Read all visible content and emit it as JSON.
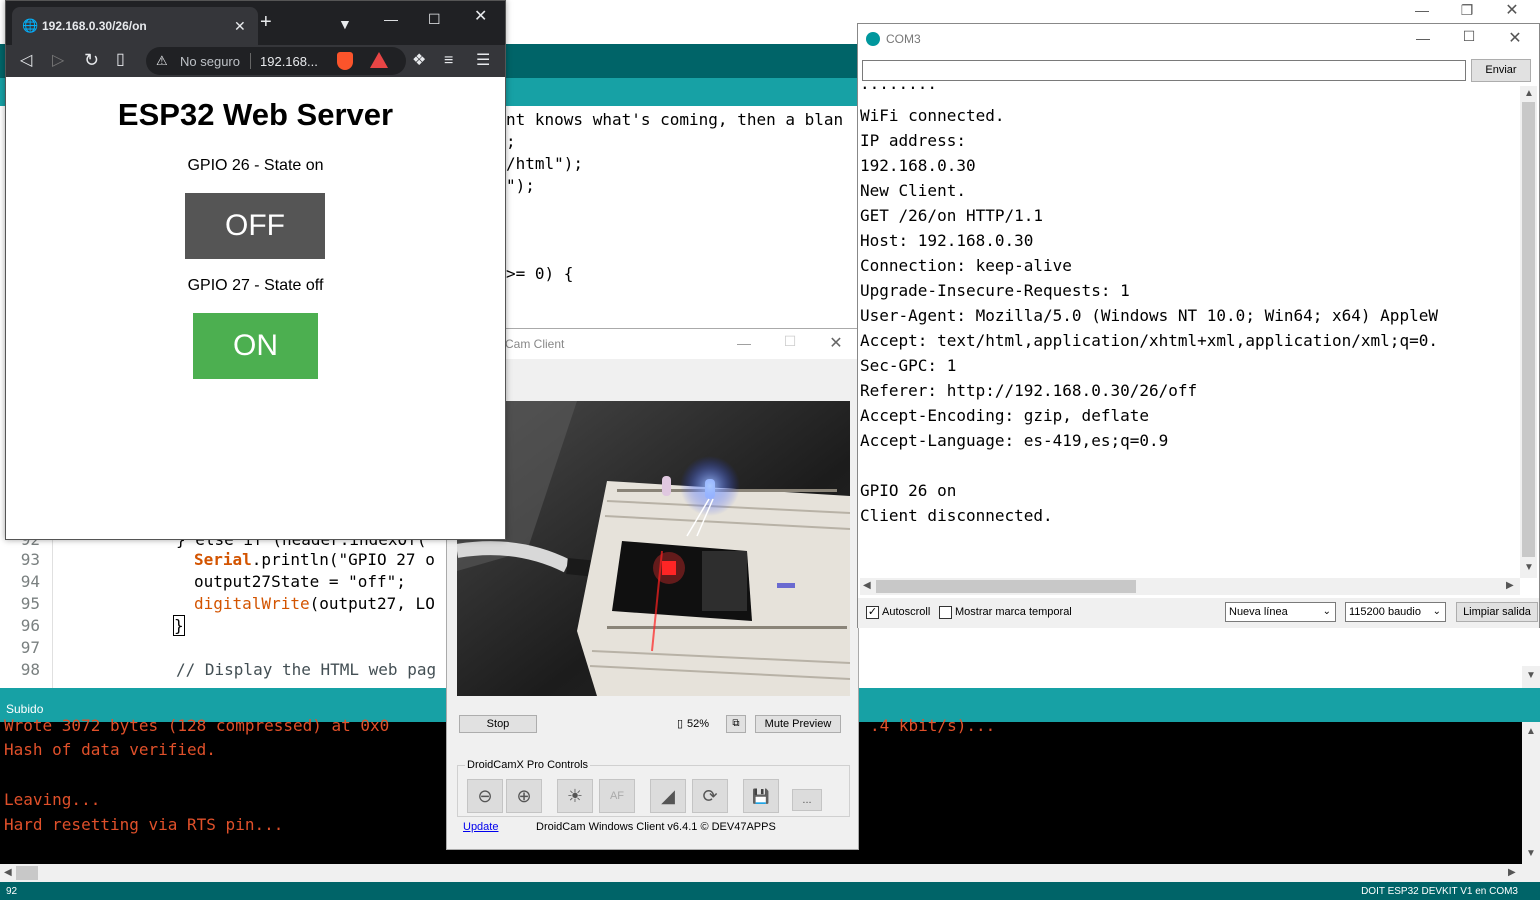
{
  "ide": {
    "code_fragments": [
      "nt knows what's coming, then a blan",
      ";",
      "/html\");",
      "\");",
      ">= 0) {"
    ],
    "lines": [
      {
        "num": "92",
        "text": "} else if (header.indexOf("
      },
      {
        "num": "93",
        "keyword": "Serial",
        "text": ".println(\"GPIO 27 o"
      },
      {
        "num": "94",
        "text": "output27State = \"off\";"
      },
      {
        "num": "95",
        "keyword": "digitalWrite",
        "text": "(output27, LO"
      },
      {
        "num": "96",
        "text": "}"
      },
      {
        "num": "97",
        "text": ""
      },
      {
        "num": "98",
        "text": "// Display the HTML web pag"
      }
    ],
    "status_label": "Subido",
    "console": [
      "Wrote 3072 bytes (128 compressed) at 0x0",
      "Hash of data verified.",
      "",
      "Leaving...",
      "Hard resetting via RTS pin..."
    ],
    "console_right_fragment": ".4 kbit/s)...",
    "bottom_line": "92",
    "bottom_board": "DOIT ESP32 DEVKIT V1 en COM3"
  },
  "browser": {
    "tab_title": "192.168.0.30/26/on",
    "security_label": "No seguro",
    "url": "192.168...",
    "page": {
      "heading": "ESP32 Web Server",
      "gpio26_label": "GPIO 26 - State on",
      "gpio26_button": "OFF",
      "gpio27_label": "GPIO 27 - State off",
      "gpio27_button": "ON"
    },
    "colors": {
      "off_button": "#555555",
      "on_button": "#4caf50"
    }
  },
  "droidcam": {
    "title": "Cam Client",
    "stop_button": "Stop",
    "battery": "52%",
    "mute_button": "Mute Preview",
    "pro_controls_label": "DroidCamX Pro Controls",
    "af_label": "AF",
    "more_label": "...",
    "update_link": "Update",
    "version": "DroidCam Windows Client v6.4.1 © DEV47APPS"
  },
  "serial": {
    "title": "COM3",
    "send_button": "Enviar",
    "output": [
      "........",
      "WiFi connected.",
      "IP address:",
      "192.168.0.30",
      "New Client.",
      "GET /26/on HTTP/1.1",
      "Host: 192.168.0.30",
      "Connection: keep-alive",
      "Upgrade-Insecure-Requests: 1",
      "User-Agent: Mozilla/5.0 (Windows NT 10.0; Win64; x64) AppleW",
      "Accept: text/html,application/xhtml+xml,application/xml;q=0.",
      "Sec-GPC: 1",
      "Referer: http://192.168.0.30/26/off",
      "Accept-Encoding: gzip, deflate",
      "Accept-Language: es-419,es;q=0.9",
      "",
      "GPIO 26 on",
      "Client disconnected."
    ],
    "autoscroll_label": "Autoscroll",
    "timestamp_label": "Mostrar marca temporal",
    "line_ending": "Nueva línea",
    "baud": "115200 baudio",
    "clear_button": "Limpiar salida"
  }
}
